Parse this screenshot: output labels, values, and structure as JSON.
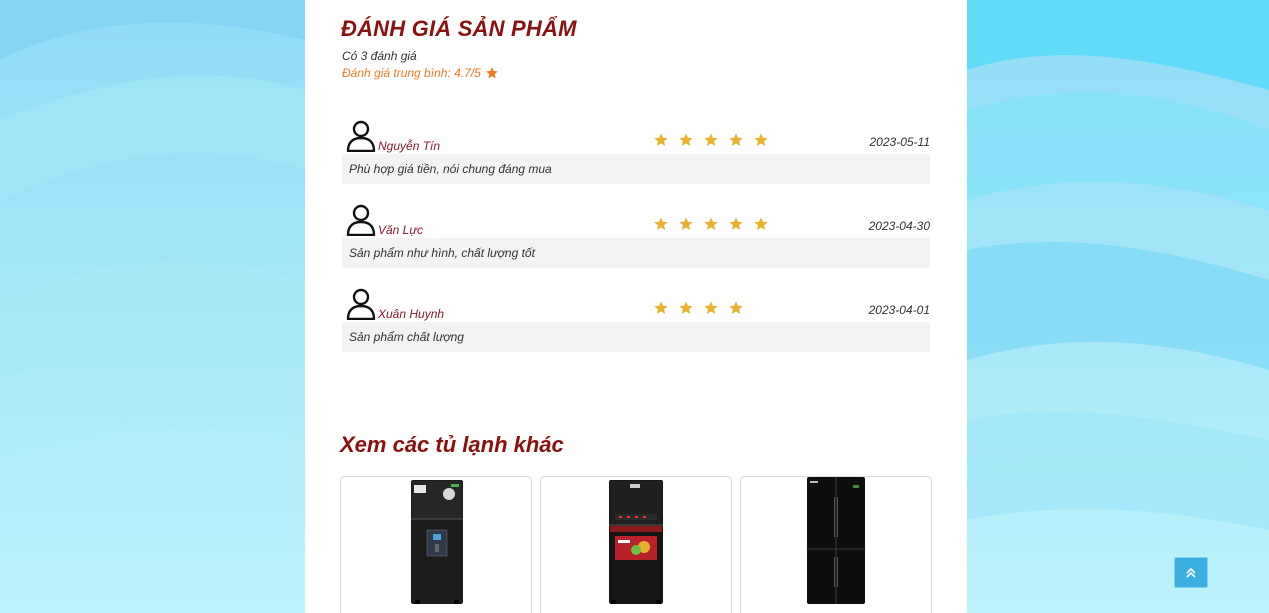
{
  "reviews_section": {
    "title": "ĐÁNH GIÁ SẢN PHẨM",
    "count_text": "Có 3 đánh giá",
    "average_text": "Đánh giá trung bình: 4.7/5",
    "average_rating": 4.7
  },
  "reviews": [
    {
      "name": "Nguyễn Tín",
      "stars": 5,
      "date": "2023-05-11",
      "comment": "Phù hợp giá tiền, nói chung đáng mua"
    },
    {
      "name": "Văn Lực",
      "stars": 5,
      "date": "2023-04-30",
      "comment": "Sản phẩm như hình, chất lượng tốt"
    },
    {
      "name": "Xuân Huynh",
      "stars": 4,
      "date": "2023-04-01",
      "comment": "Sản phẩm chất lượng"
    }
  ],
  "related": {
    "title": "Xem các tủ lạnh khác",
    "products": [
      {
        "image": "fridge-top-freezer-water-dispenser"
      },
      {
        "image": "fridge-top-freezer-glass-door"
      },
      {
        "image": "fridge-side-by-side-4-door"
      }
    ]
  },
  "colors": {
    "heading": "#8b1010",
    "accent_orange": "#f07a22",
    "star": "#e8b230",
    "page_bg": "#9be4f7",
    "to_top_button": "#3aaee0"
  },
  "icons": {
    "user": "user-icon",
    "star": "star-icon",
    "to_top": "chevron-double-up-icon"
  }
}
